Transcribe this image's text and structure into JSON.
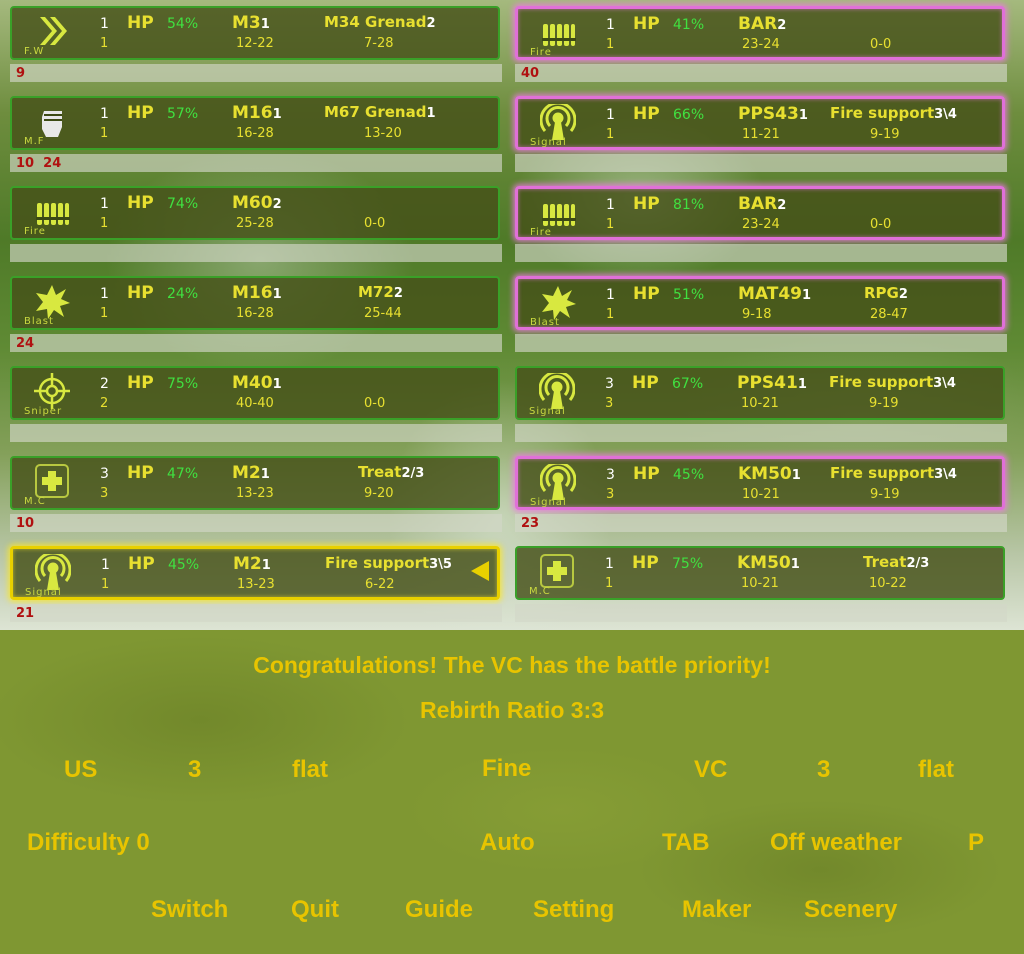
{
  "units": [
    {
      "side": "left",
      "border": "green",
      "icon": "chevron-icon",
      "role": "F.W",
      "count": "1",
      "count2": "1",
      "hp": "54%",
      "w1": "M3",
      "w1n": "1",
      "w1r": "12-22",
      "w2": "M34 Grenad",
      "w2n": "2",
      "w2r": "7-28",
      "badge": "9"
    },
    {
      "side": "right",
      "border": "pink",
      "icon": "ammo-icon",
      "role": "Fire",
      "count": "1",
      "count2": "1",
      "hp": "41%",
      "w1": "BAR",
      "w1n": "2",
      "w1r": "23-24",
      "w2": "",
      "w2n": "",
      "w2r": "0-0",
      "badge": "40"
    },
    {
      "side": "left",
      "border": "green",
      "icon": "fist-icon",
      "role": "M.F",
      "count": "1",
      "count2": "1",
      "hp": "57%",
      "w1": "M16",
      "w1n": "1",
      "w1r": "16-28",
      "w2": "M67 Grenad",
      "w2n": "1",
      "w2r": "13-20",
      "badge": "10  24"
    },
    {
      "side": "right",
      "border": "pink",
      "icon": "signal-icon",
      "role": "Signal",
      "count": "1",
      "count2": "1",
      "hp": "66%",
      "w1": "PPS43",
      "w1n": "1",
      "w1r": "11-21",
      "w2": "Fire support",
      "w2n": "3\\4",
      "w2r": "9-19",
      "badge": ""
    },
    {
      "side": "left",
      "border": "green",
      "icon": "ammo-icon",
      "role": "Fire",
      "count": "1",
      "count2": "1",
      "hp": "74%",
      "w1": "M60",
      "w1n": "2",
      "w1r": "25-28",
      "w2": "",
      "w2n": "",
      "w2r": "0-0",
      "badge": ""
    },
    {
      "side": "right",
      "border": "pink",
      "icon": "ammo-icon",
      "role": "Fire",
      "count": "1",
      "count2": "1",
      "hp": "81%",
      "w1": "BAR",
      "w1n": "2",
      "w1r": "23-24",
      "w2": "",
      "w2n": "",
      "w2r": "0-0",
      "badge": ""
    },
    {
      "side": "left",
      "border": "green",
      "icon": "blast-icon",
      "role": "Blast",
      "count": "1",
      "count2": "1",
      "hp": "24%",
      "w1": "M16",
      "w1n": "1",
      "w1r": "16-28",
      "w2": "M72",
      "w2n": "2",
      "w2r": "25-44",
      "badge": "24"
    },
    {
      "side": "right",
      "border": "pink",
      "icon": "blast-icon",
      "role": "Blast",
      "count": "1",
      "count2": "1",
      "hp": "51%",
      "w1": "MAT49",
      "w1n": "1",
      "w1r": "9-18",
      "w2": "RPG",
      "w2n": "2",
      "w2r": "28-47",
      "badge": ""
    },
    {
      "side": "left",
      "border": "green",
      "icon": "crosshair-icon",
      "role": "Sniper",
      "count": "2",
      "count2": "2",
      "hp": "75%",
      "w1": "M40",
      "w1n": "1",
      "w1r": "40-40",
      "w2": "",
      "w2n": "",
      "w2r": "0-0",
      "badge": ""
    },
    {
      "side": "right",
      "border": "green",
      "icon": "signal-icon",
      "role": "Signal",
      "count": "3",
      "count2": "3",
      "hp": "67%",
      "w1": "PPS41",
      "w1n": "1",
      "w1r": "10-21",
      "w2": "Fire support",
      "w2n": "3\\4",
      "w2r": "9-19",
      "badge": ""
    },
    {
      "side": "left",
      "border": "green",
      "icon": "medic-icon",
      "role": "M.C",
      "count": "3",
      "count2": "3",
      "hp": "47%",
      "w1": "M2",
      "w1n": "1",
      "w1r": "13-23",
      "w2": "Treat",
      "w2n": "2/3",
      "w2r": "9-20",
      "badge": "10"
    },
    {
      "side": "right",
      "border": "pink",
      "icon": "signal-icon",
      "role": "Signal",
      "count": "3",
      "count2": "3",
      "hp": "45%",
      "w1": "KM50",
      "w1n": "1",
      "w1r": "10-21",
      "w2": "Fire support",
      "w2n": "3\\4",
      "w2r": "9-19",
      "badge": "23"
    },
    {
      "side": "left",
      "border": "yellow",
      "icon": "signal-icon",
      "role": "Signal",
      "count": "1",
      "count2": "1",
      "hp": "45%",
      "w1": "M2",
      "w1n": "1",
      "w1r": "13-23",
      "w2": "Fire support",
      "w2n": "3\\5",
      "w2r": "6-22",
      "badge": "21"
    },
    {
      "side": "right",
      "border": "green",
      "icon": "medic-icon",
      "role": "M.C",
      "count": "1",
      "count2": "1",
      "hp": "75%",
      "w1": "KM50",
      "w1n": "1",
      "w1r": "10-21",
      "w2": "Treat",
      "w2n": "2/3",
      "w2r": "10-22",
      "badge": ""
    }
  ],
  "message": {
    "line1": "Congratulations!  The VC has the battle priority!",
    "line2": "Rebirth Ratio  3:3"
  },
  "row1": {
    "us": "US",
    "us_count": "3",
    "us_terrain": "flat",
    "weather": "Fine",
    "vc": "VC",
    "vc_count": "3",
    "vc_terrain": "flat"
  },
  "row2": {
    "difficulty": "Difficulty  0",
    "auto": "Auto",
    "tab": "TAB",
    "weather_toggle": "Off weather",
    "p": "P"
  },
  "row3": {
    "switch": "Switch",
    "quit": "Quit",
    "guide": "Guide",
    "setting": "Setting",
    "maker": "Maker",
    "scenery": "Scenery"
  },
  "colors": {
    "text_yellow": "#e8c400",
    "green_border": "#3aa028",
    "pink_border": "#e070d8",
    "selected_border": "#e8d000",
    "hp_green": "#40e040",
    "badge_red": "#b01010"
  }
}
